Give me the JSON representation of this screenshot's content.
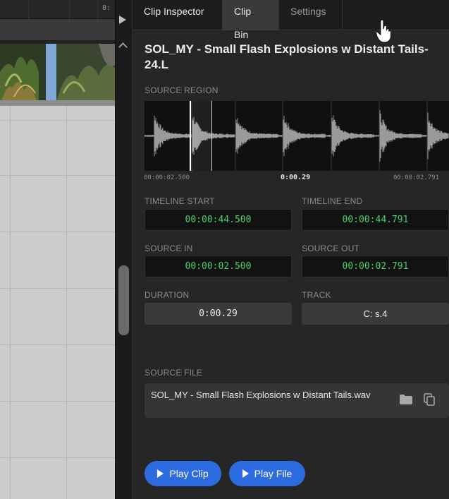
{
  "timeline": {
    "ruler_label": "0:"
  },
  "tabs": [
    {
      "label": "Clip Inspector"
    },
    {
      "label": "Clip Bin"
    },
    {
      "label": "Settings"
    }
  ],
  "clip": {
    "title": "SOL_MY - Small Flash Explosions w Distant Tails-24.L"
  },
  "source_region": {
    "label": "SOURCE REGION",
    "start": "00:00:02.500",
    "duration": "0:00.29",
    "end": "00:00:02.791"
  },
  "fields": {
    "timeline_start": {
      "label": "TIMELINE START",
      "value": "00:00:44.500"
    },
    "timeline_end": {
      "label": "TIMELINE END",
      "value": "00:00:44.791"
    },
    "source_in": {
      "label": "SOURCE IN",
      "value": "00:00:02.500"
    },
    "source_out": {
      "label": "SOURCE OUT",
      "value": "00:00:02.791"
    },
    "duration": {
      "label": "DURATION",
      "value": "0:00.29"
    },
    "track": {
      "label": "TRACK",
      "value": "C: s.4"
    }
  },
  "source_file": {
    "label": "SOURCE FILE",
    "name": "SOL_MY - Small Flash Explosions w Distant Tails.wav"
  },
  "buttons": {
    "play_clip": "Play Clip",
    "play_file": "Play File"
  },
  "icons": [
    "play-arrow-icon",
    "chevron-up-icon",
    "hand-cursor-icon",
    "folder-icon",
    "copy-icon",
    "play-icon"
  ],
  "colors": {
    "accent_button": "#2d6be0",
    "timecode_green": "#47d16a",
    "panel_bg": "#262626",
    "field_bg": "#121212"
  }
}
